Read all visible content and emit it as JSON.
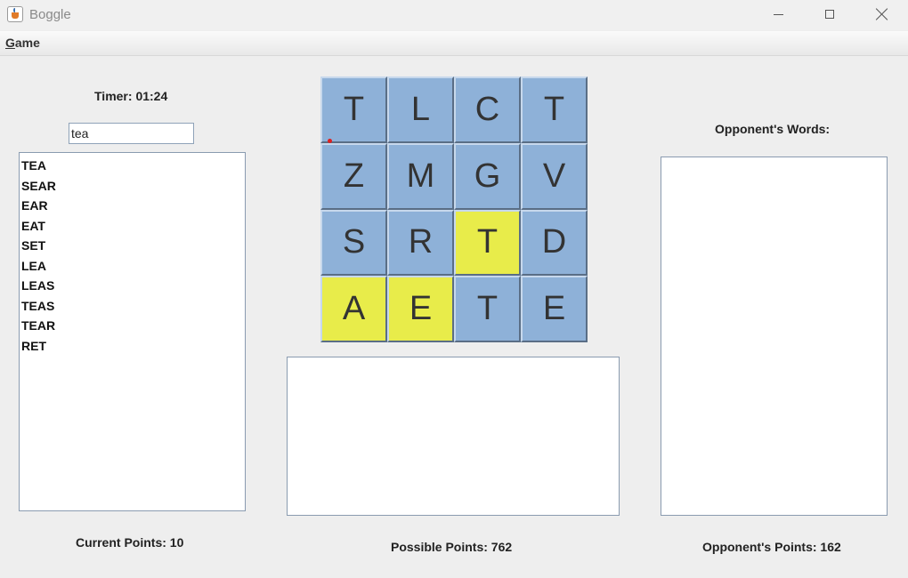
{
  "window": {
    "title": "Boggle"
  },
  "menu": {
    "game_first": "G",
    "game_rest": "ame"
  },
  "left": {
    "timer_label": "Timer:",
    "timer_value": "01:24",
    "input_value": "tea",
    "found_words": [
      "TEA",
      "SEAR",
      "EAR",
      "EAT",
      "SET",
      "LEA",
      "LEAS",
      "TEAS",
      "TEAR",
      "RET"
    ],
    "current_points_label": "Current Points: 10"
  },
  "board": {
    "tiles": [
      {
        "letter": "T",
        "selected": false
      },
      {
        "letter": "L",
        "selected": false
      },
      {
        "letter": "C",
        "selected": false
      },
      {
        "letter": "T",
        "selected": false
      },
      {
        "letter": "Z",
        "selected": false
      },
      {
        "letter": "M",
        "selected": false
      },
      {
        "letter": "G",
        "selected": false
      },
      {
        "letter": "V",
        "selected": false
      },
      {
        "letter": "S",
        "selected": false
      },
      {
        "letter": "R",
        "selected": false
      },
      {
        "letter": "T",
        "selected": true
      },
      {
        "letter": "D",
        "selected": false
      },
      {
        "letter": "A",
        "selected": true
      },
      {
        "letter": "E",
        "selected": true
      },
      {
        "letter": "T",
        "selected": false
      },
      {
        "letter": "E",
        "selected": false
      }
    ],
    "possible_points_label": "Possible Points: 762"
  },
  "right": {
    "opponent_words_label": "Opponent's Words:",
    "opponent_points_label": "Opponent's Points: 162"
  },
  "colors": {
    "tile": "#8eb1d8",
    "tile_selected": "#e8ec4a"
  }
}
